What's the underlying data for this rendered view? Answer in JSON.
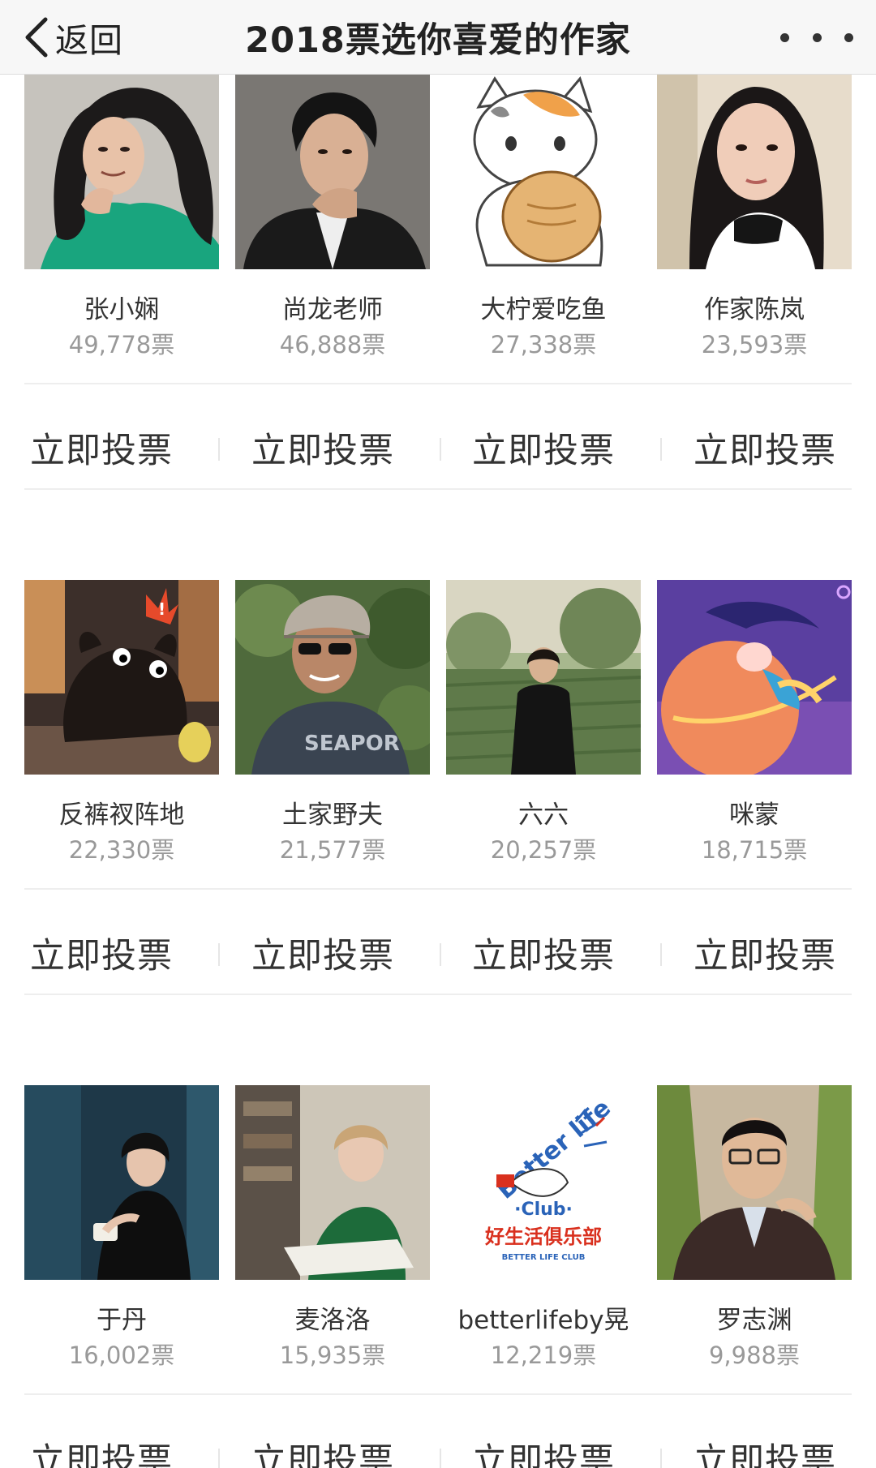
{
  "header": {
    "back_label": "返回",
    "title": "2018票选你喜爱的作家"
  },
  "vote_button_label": "立即投票",
  "groups": [
    {
      "items": [
        {
          "name": "张小娴",
          "votes": "49,778票"
        },
        {
          "name": "尚龙老师",
          "votes": "46,888票"
        },
        {
          "name": "大柠爱吃鱼",
          "votes": "27,338票"
        },
        {
          "name": "作家陈岚",
          "votes": "23,593票"
        }
      ]
    },
    {
      "items": [
        {
          "name": "反裤衩阵地",
          "votes": "22,330票"
        },
        {
          "name": "土家野夫",
          "votes": "21,577票"
        },
        {
          "name": "六六",
          "votes": "20,257票"
        },
        {
          "name": "咪蒙",
          "votes": "18,715票"
        }
      ]
    },
    {
      "items": [
        {
          "name": "于丹",
          "votes": "16,002票"
        },
        {
          "name": "麦洛洛",
          "votes": "15,935票"
        },
        {
          "name": "betterlifeby晃",
          "votes": "12,219票"
        },
        {
          "name": "罗志渊",
          "votes": "9,988票"
        }
      ]
    }
  ],
  "logo": {
    "line1": "Better life",
    "line2": "·Club·",
    "line3": "好生活俱乐部",
    "line4": "BETTER LIFE CLUB"
  }
}
